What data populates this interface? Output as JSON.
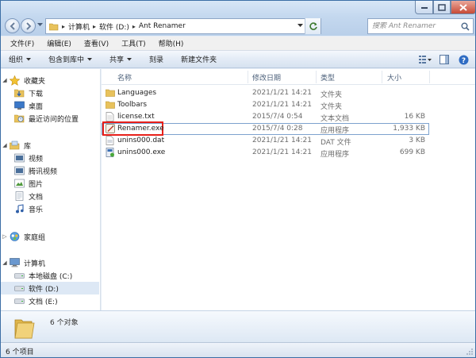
{
  "window": {
    "address": [
      "计算机",
      "软件 (D:)",
      "Ant Renamer"
    ],
    "search_placeholder": "搜索 Ant Renamer"
  },
  "menubar": [
    "文件(F)",
    "编辑(E)",
    "查看(V)",
    "工具(T)",
    "帮助(H)"
  ],
  "commandbar": {
    "organize": "组织",
    "include_library": "包含到库中",
    "share": "共享",
    "burn": "刻录",
    "new_folder": "新建文件夹"
  },
  "navpane": {
    "favorites": "收藏夹",
    "favorites_items": [
      "下载",
      "桌面",
      "最近访问的位置"
    ],
    "libraries": "库",
    "library_items": [
      "视频",
      "腾讯视频",
      "图片",
      "文档",
      "音乐"
    ],
    "homegroup": "家庭组",
    "computer": "计算机",
    "drives": [
      "本地磁盘 (C:)",
      "软件 (D:)",
      "文档 (E:)"
    ]
  },
  "columns": {
    "name": "名称",
    "date": "修改日期",
    "type": "类型",
    "size": "大小"
  },
  "files": [
    {
      "name": "Languages",
      "date": "2021/1/21 14:21",
      "type": "文件夹",
      "size": "",
      "icon": "folder-icon"
    },
    {
      "name": "Toolbars",
      "date": "2021/1/21 14:21",
      "type": "文件夹",
      "size": "",
      "icon": "folder-icon"
    },
    {
      "name": "license.txt",
      "date": "2015/7/4 0:54",
      "type": "文本文档",
      "size": "16 KB",
      "icon": "text-file-icon"
    },
    {
      "name": "Renamer.exe",
      "date": "2015/7/4 0:28",
      "type": "应用程序",
      "size": "1,933 KB",
      "icon": "app-icon"
    },
    {
      "name": "unins000.dat",
      "date": "2021/1/21 14:21",
      "type": "DAT 文件",
      "size": "3 KB",
      "icon": "dat-file-icon"
    },
    {
      "name": "unins000.exe",
      "date": "2021/1/21 14:21",
      "type": "应用程序",
      "size": "699 KB",
      "icon": "uninstaller-icon"
    }
  ],
  "details": {
    "count": "6 个对象"
  },
  "status": {
    "text": "6 个项目"
  },
  "colors": {
    "highlight_box": "#e8201a",
    "selected_bg": "#dde8f5"
  }
}
